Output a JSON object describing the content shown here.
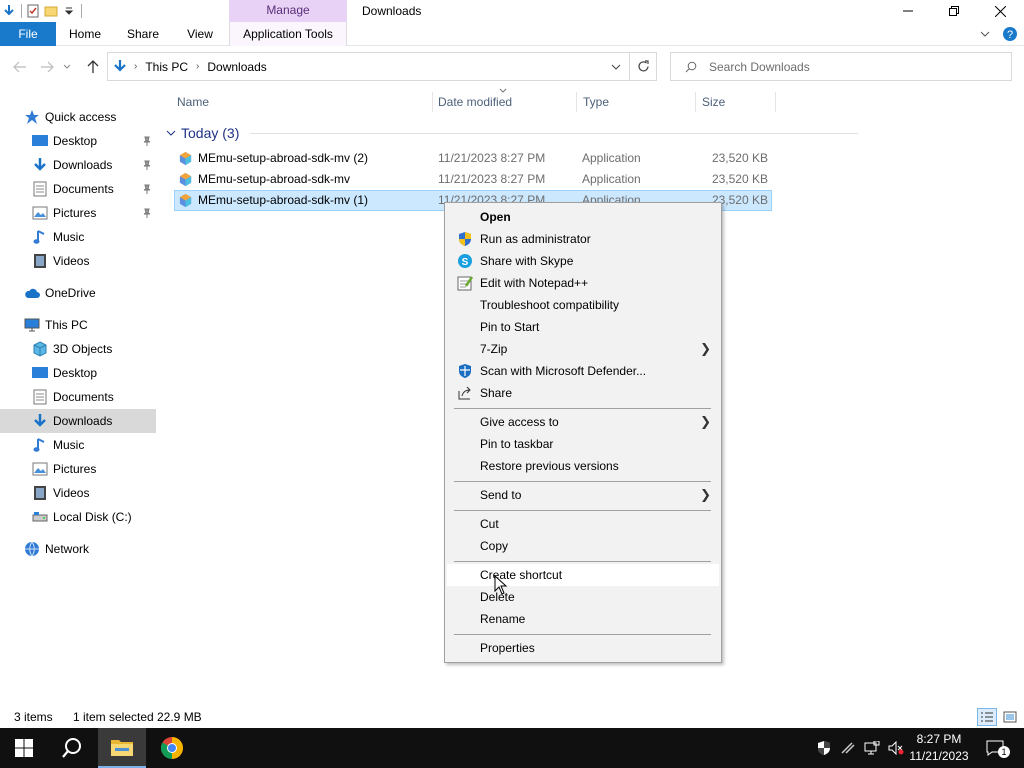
{
  "window": {
    "title": "Downloads",
    "manage_tab": "Manage"
  },
  "ribbon": {
    "tabs": [
      "File",
      "Home",
      "Share",
      "View",
      "Application Tools"
    ]
  },
  "address": {
    "segments": [
      "This PC",
      "Downloads"
    ],
    "search_placeholder": "Search Downloads"
  },
  "navpane": {
    "items": [
      {
        "label": "Quick access",
        "icon": "star-icon"
      },
      {
        "label": "Desktop",
        "icon": "desktop-icon",
        "pinned": true
      },
      {
        "label": "Downloads",
        "icon": "download-icon",
        "pinned": true
      },
      {
        "label": "Documents",
        "icon": "document-icon",
        "pinned": true
      },
      {
        "label": "Pictures",
        "icon": "pictures-icon",
        "pinned": true
      },
      {
        "label": "Music",
        "icon": "music-icon"
      },
      {
        "label": "Videos",
        "icon": "videos-icon"
      },
      {
        "label": "OneDrive",
        "icon": "cloud-icon"
      },
      {
        "label": "This PC",
        "icon": "computer-icon"
      },
      {
        "label": "3D Objects",
        "icon": "cube-icon"
      },
      {
        "label": "Desktop",
        "icon": "desktop-icon"
      },
      {
        "label": "Documents",
        "icon": "document-icon"
      },
      {
        "label": "Downloads",
        "icon": "download-icon",
        "selected": true
      },
      {
        "label": "Music",
        "icon": "music-icon"
      },
      {
        "label": "Pictures",
        "icon": "pictures-icon"
      },
      {
        "label": "Videos",
        "icon": "videos-icon"
      },
      {
        "label": "Local Disk (C:)",
        "icon": "disk-icon"
      },
      {
        "label": "Network",
        "icon": "network-icon"
      }
    ]
  },
  "columns": [
    "Name",
    "Date modified",
    "Type",
    "Size"
  ],
  "group": {
    "label": "Today (3)"
  },
  "files": [
    {
      "name": "MEmu-setup-abroad-sdk-mv (2)",
      "date": "11/21/2023 8:27 PM",
      "type": "Application",
      "size": "23,520 KB"
    },
    {
      "name": "MEmu-setup-abroad-sdk-mv",
      "date": "11/21/2023 8:27 PM",
      "type": "Application",
      "size": "23,520 KB"
    },
    {
      "name": "MEmu-setup-abroad-sdk-mv (1)",
      "date": "11/21/2023 8:27 PM",
      "type": "Application",
      "size": "23,520 KB",
      "selected": true
    }
  ],
  "context_menu": {
    "items": [
      {
        "label": "Open",
        "bold": true
      },
      {
        "label": "Run as administrator",
        "icon": "shield-icon"
      },
      {
        "label": "Share with Skype",
        "icon": "skype-icon"
      },
      {
        "label": "Edit with Notepad++",
        "icon": "notepadpp-icon"
      },
      {
        "label": "Troubleshoot compatibility"
      },
      {
        "label": "Pin to Start"
      },
      {
        "label": "7-Zip",
        "submenu": true
      },
      {
        "label": "Scan with Microsoft Defender...",
        "icon": "defender-icon"
      },
      {
        "label": "Share",
        "icon": "share-icon"
      },
      {
        "separator": true
      },
      {
        "label": "Give access to",
        "submenu": true
      },
      {
        "label": "Pin to taskbar"
      },
      {
        "label": "Restore previous versions"
      },
      {
        "separator": true
      },
      {
        "label": "Send to",
        "submenu": true
      },
      {
        "separator": true
      },
      {
        "label": "Cut"
      },
      {
        "label": "Copy"
      },
      {
        "separator": true
      },
      {
        "label": "Create shortcut",
        "hover": true
      },
      {
        "label": "Delete"
      },
      {
        "label": "Rename"
      },
      {
        "separator": true
      },
      {
        "label": "Properties"
      }
    ]
  },
  "status": {
    "items_count": "3 items",
    "selection": "1 item selected",
    "selection_size": "22.9 MB"
  },
  "taskbar": {
    "time": "8:27 PM",
    "date": "11/21/2023",
    "notification_count": "1"
  },
  "colors": {
    "accent": "#1979ca",
    "selection": "#cce8ff",
    "manage": "#e8d2f5"
  }
}
